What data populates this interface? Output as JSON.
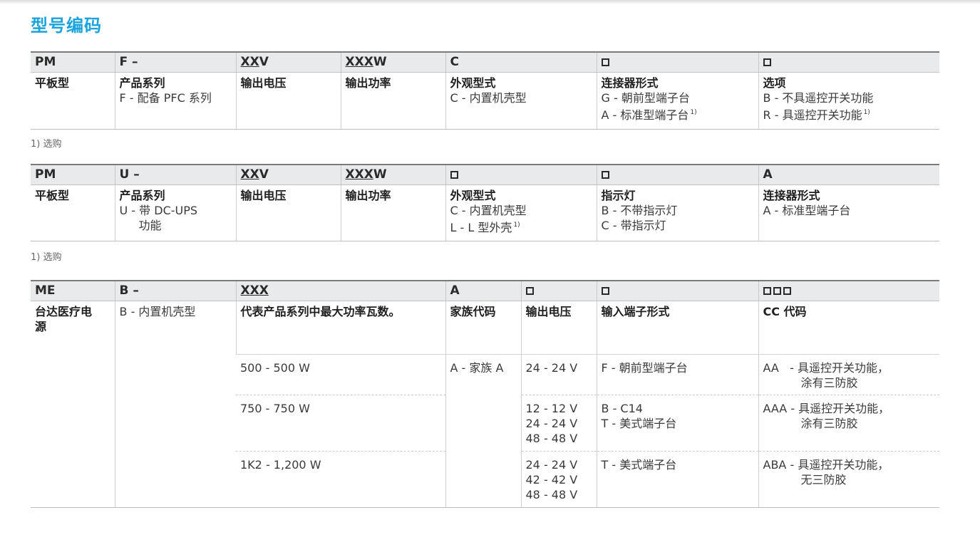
{
  "title": "型号编码",
  "footnote": "1) 选购",
  "t1": {
    "headers": [
      "PM",
      "F –",
      "XXV",
      "XXXW",
      "C"
    ],
    "desc": [
      {
        "label": "平板型"
      },
      {
        "label": "产品系列",
        "lines": [
          "F - 配备 PFC 系列"
        ]
      },
      {
        "label": "输出电压"
      },
      {
        "label": "输出功率"
      },
      {
        "label": "外观型式",
        "lines": [
          "C - 内置机壳型"
        ]
      },
      {
        "label": "连接器形式",
        "lines": [
          "G - 朝前型端子台",
          "A - 标准型端子台"
        ]
      },
      {
        "label": "选项",
        "lines": [
          "B - 不具遥控开关功能",
          "R - 具遥控开关功能"
        ]
      }
    ],
    "sup": "1)"
  },
  "t2": {
    "headers": [
      "PM",
      "U –",
      "XXV",
      "XXXW",
      "A"
    ],
    "desc": [
      {
        "label": "平板型"
      },
      {
        "label": "产品系列",
        "lines": [
          "U - 带 DC-UPS",
          "功能"
        ]
      },
      {
        "label": "输出电压"
      },
      {
        "label": "输出功率"
      },
      {
        "label": "外观型式",
        "lines": [
          "C - 内置机壳型",
          "L - L 型外壳"
        ]
      },
      {
        "label": "指示灯",
        "lines": [
          "B - 不带指示灯",
          "C - 带指示灯"
        ]
      },
      {
        "label": "连接器形式",
        "lines": [
          "A - 标准型端子台"
        ]
      }
    ],
    "sup": "1)"
  },
  "t3": {
    "headers": [
      "ME",
      "B –",
      "XXX",
      "A"
    ],
    "labels": {
      "brand": "台达医疗电源",
      "series": "B - 内置机壳型",
      "power": "代表产品系列中最大功率瓦数。",
      "family": "家族代码",
      "vout": "输出电压",
      "input": "输入端子形式",
      "cc": "CC 代码"
    },
    "family_value": "A - 家族 A",
    "rows": [
      {
        "power": "500 - 500 W",
        "vout": [
          "24 - 24 V"
        ],
        "input": [
          "F - 朝前型端子台"
        ],
        "cc": [
          "AA   - 具遥控开关功能，",
          "涂有三防胶"
        ]
      },
      {
        "power": "750 - 750 W",
        "vout": [
          "12 - 12 V",
          "24 - 24 V",
          "48 - 48 V"
        ],
        "input": [
          "B - C14",
          "T - 美式端子台"
        ],
        "cc": [
          "AAA - 具遥控开关功能，",
          "涂有三防胶"
        ]
      },
      {
        "power": "1K2 - 1,200 W",
        "vout": [
          "24 - 24 V",
          "42 - 42 V",
          "48 - 48 V"
        ],
        "input": [
          "T - 美式端子台"
        ],
        "cc": [
          "ABA - 具遥控开关功能，",
          "无三防胶"
        ]
      }
    ]
  }
}
